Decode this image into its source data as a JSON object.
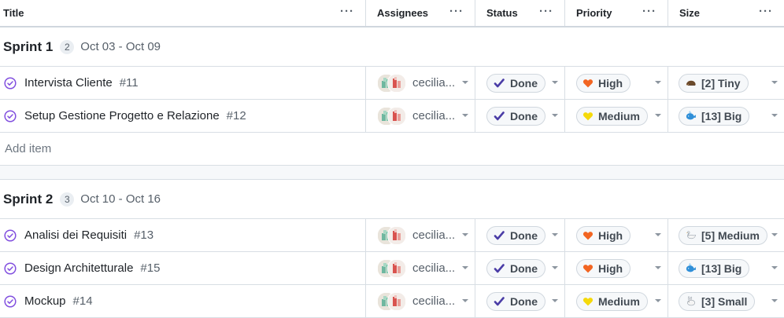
{
  "columns": [
    {
      "label": "Title"
    },
    {
      "label": "Assignees"
    },
    {
      "label": "Status"
    },
    {
      "label": "Priority"
    },
    {
      "label": "Size"
    }
  ],
  "groups": [
    {
      "name": "Sprint 1",
      "count": "2",
      "dates": "Oct 03 - Oct 09",
      "items": [
        {
          "title": "Intervista Cliente",
          "number": "#11",
          "assignee": "cecilia...",
          "status": "Done",
          "priority": "High",
          "priority_icon": "orange-heart",
          "size": "[2] Tiny",
          "size_icon": "hedgehog"
        },
        {
          "title": "Setup Gestione Progetto e Relazione",
          "number": "#12",
          "assignee": "cecilia...",
          "status": "Done",
          "priority": "Medium",
          "priority_icon": "yellow-heart",
          "size": "[13] Big",
          "size_icon": "whale"
        }
      ],
      "add_label": "Add item"
    },
    {
      "name": "Sprint 2",
      "count": "3",
      "dates": "Oct 10 - Oct 16",
      "items": [
        {
          "title": "Analisi dei Requisiti",
          "number": "#13",
          "assignee": "cecilia...",
          "status": "Done",
          "priority": "High",
          "priority_icon": "orange-heart",
          "size": "[5] Medium",
          "size_icon": "swan"
        },
        {
          "title": "Design Architetturale",
          "number": "#15",
          "assignee": "cecilia...",
          "status": "Done",
          "priority": "High",
          "priority_icon": "orange-heart",
          "size": "[13] Big",
          "size_icon": "whale"
        },
        {
          "title": "Mockup",
          "number": "#14",
          "assignee": "cecilia...",
          "status": "Done",
          "priority": "Medium",
          "priority_icon": "yellow-heart",
          "size": "[3] Small",
          "size_icon": "rabbit"
        }
      ]
    }
  ],
  "colors": {
    "status_check": "#4a3ca6",
    "issue_done": "#8250df",
    "high_heart": "#f26522",
    "medium_heart": "#f5d90a",
    "whale": "#2f8fd8"
  }
}
